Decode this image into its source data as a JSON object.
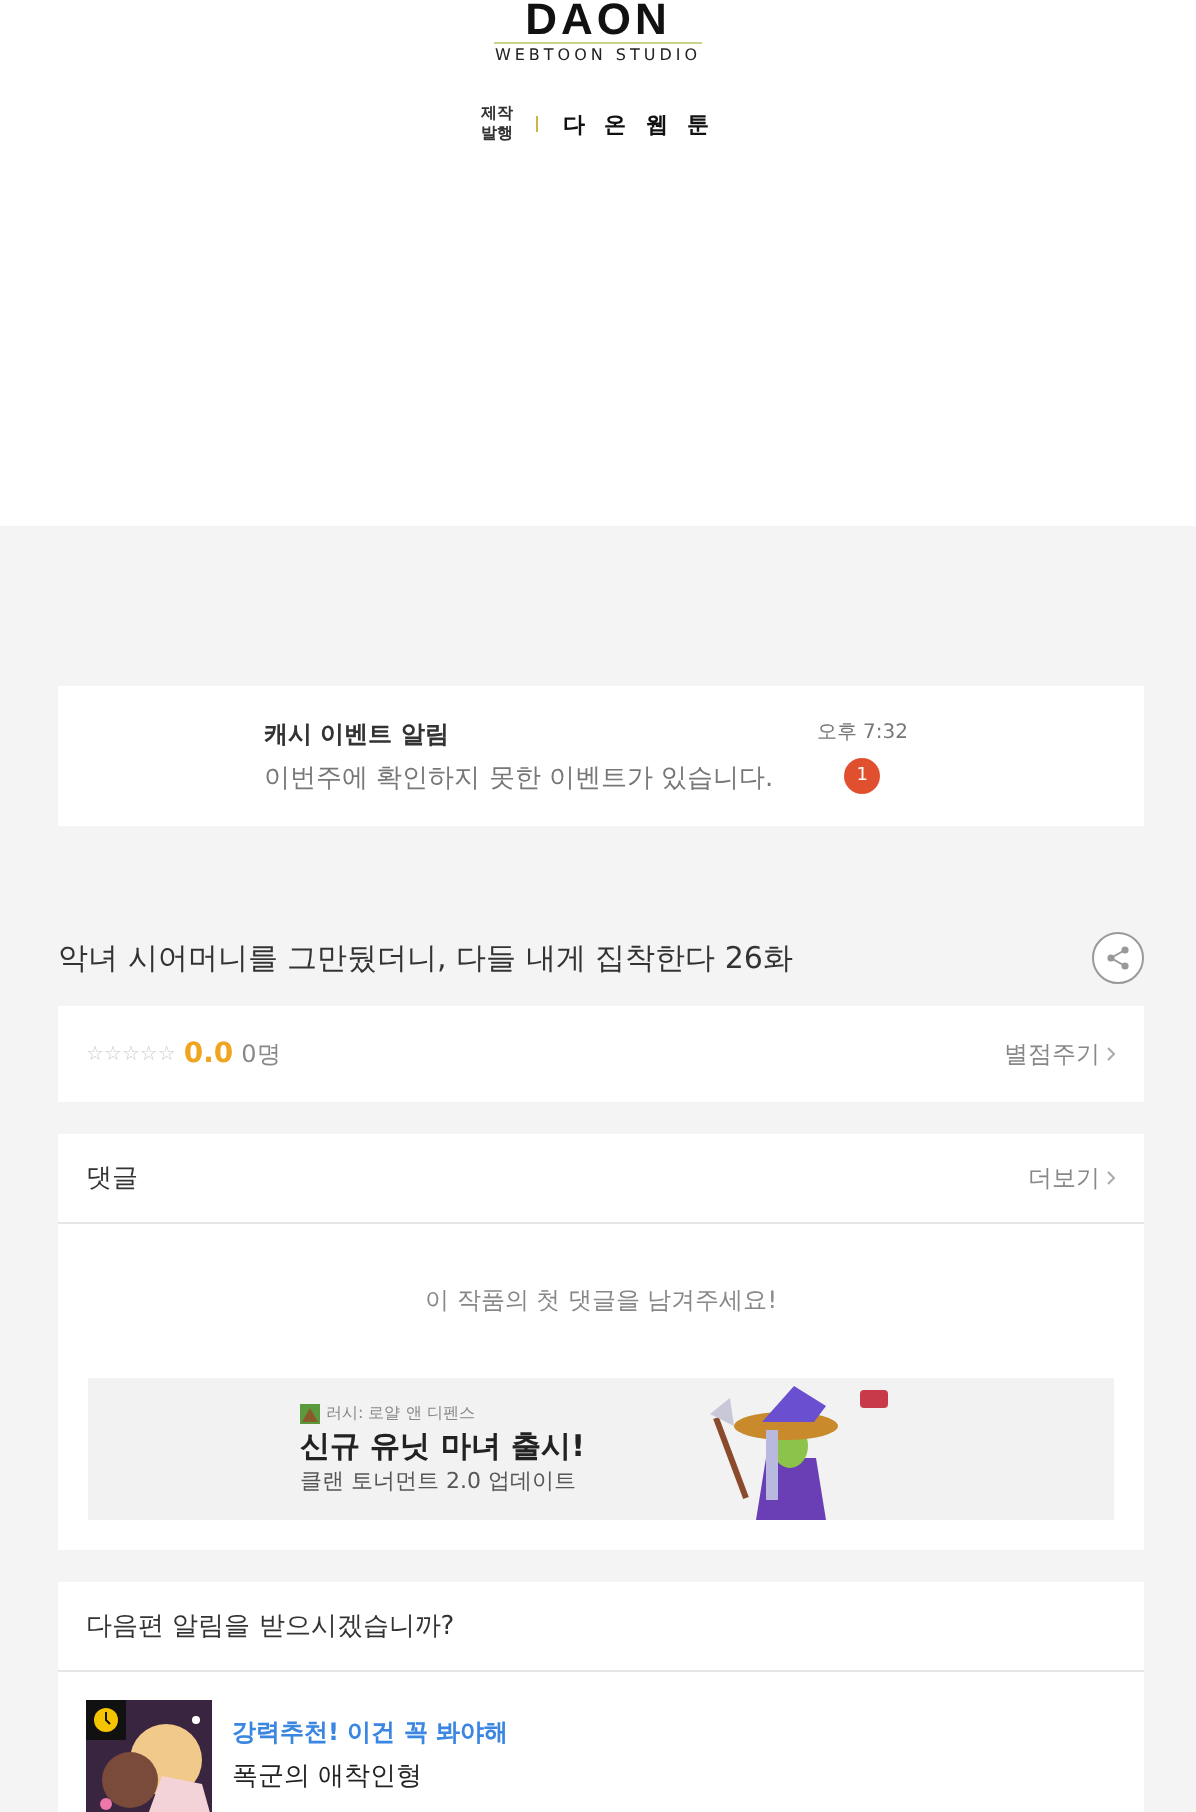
{
  "header": {
    "logo": "DAON",
    "logo_sub": "WEBTOON STUDIO",
    "credit_label": "제작\n발행",
    "publisher": "다 온 웹 툰"
  },
  "notice": {
    "title": "캐시 이벤트 알림",
    "message": "이번주에 확인하지 못한 이벤트가 있습니다.",
    "time": "오후 7:32",
    "badge": "1"
  },
  "episode": {
    "title": "악녀 시어머니를 그만뒀더니, 다들 내게 집착한다 26화"
  },
  "rating": {
    "stars": 0,
    "score": "0.0",
    "count": "0명",
    "action": "별점주기"
  },
  "comments": {
    "title": "댓글",
    "more": "더보기",
    "empty": "이 작품의 첫 댓글을 남겨주세요!"
  },
  "ad": {
    "kind": "picture",
    "source": "러시: 로얄 앤 디펜스",
    "headline": "신규 유닛 마녀 출시!",
    "subline": "클랜 토너먼트 2.0 업데이트"
  },
  "next": {
    "question": "다음편 알림을 받으시겠습니까?",
    "items": [
      {
        "tag": "강력추천! 이건 꼭 봐야해",
        "title": "폭군의 애착인형"
      }
    ]
  }
}
